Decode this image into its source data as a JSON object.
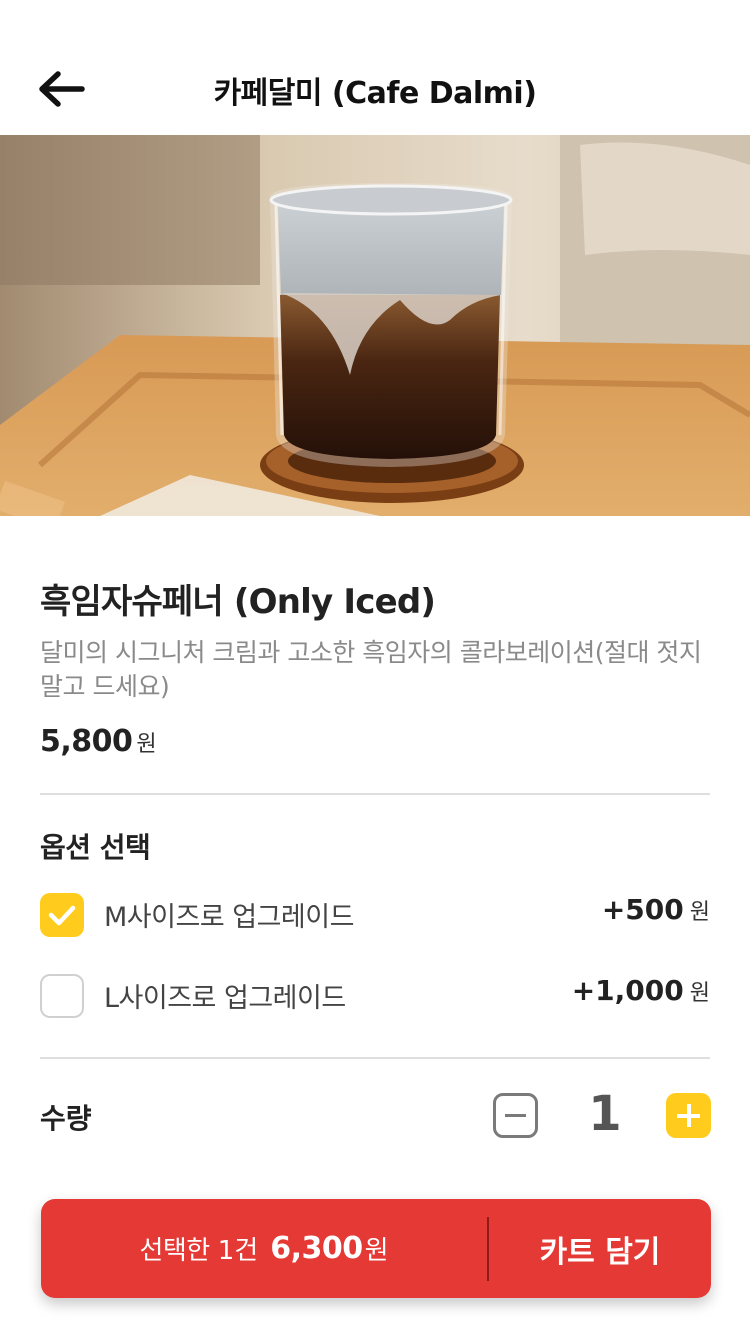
{
  "header": {
    "title": "카페달미 (Cafe Dalmi)",
    "back_icon": "arrow-left-icon"
  },
  "product": {
    "name": "흑임자슈페너 (Only Iced)",
    "description": "달미의 시그니처 크림과 고소한 흑임자의 콜라보레이션(절대 젓지말고 드세요)",
    "price": "5,800",
    "price_unit": "원"
  },
  "options": {
    "title": "옵션 선택",
    "items": [
      {
        "label": "M사이즈로 업그레이드",
        "price": "+500",
        "unit": "원",
        "checked": true
      },
      {
        "label": "L사이즈로 업그레이드",
        "price": "+1,000",
        "unit": "원",
        "checked": false
      }
    ]
  },
  "quantity": {
    "label": "수량",
    "value": "1"
  },
  "bottom_bar": {
    "summary_text": "선택한",
    "count": "1건",
    "total": "6,300",
    "unit": "원",
    "add_to_cart": "카트 담기"
  },
  "colors": {
    "accent_yellow": "#ffcc1d",
    "cta_red": "#e53935"
  }
}
